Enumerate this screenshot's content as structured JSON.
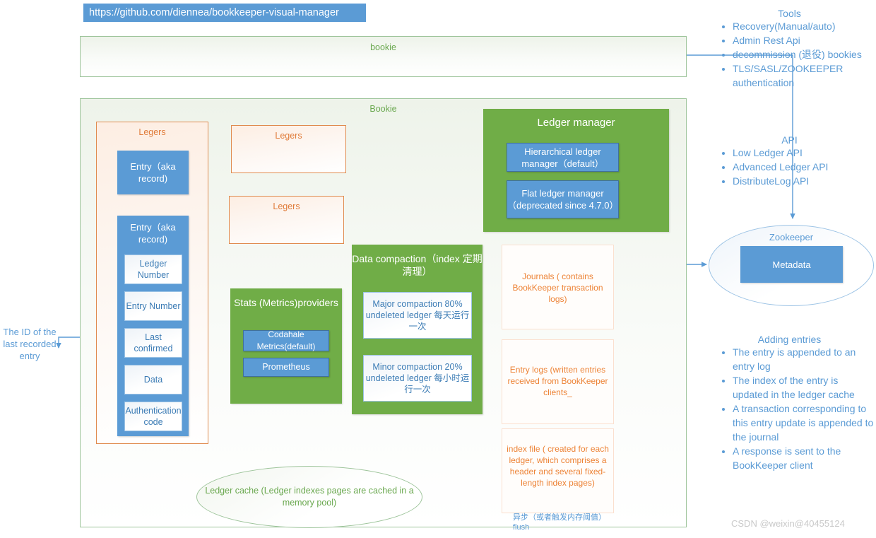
{
  "url_chip": {
    "text": "https://github.com/diennea/bookkeeper-visual-manager"
  },
  "colors": {
    "blue": "#5b9bd5",
    "green": "#70ad47",
    "orange": "#ed8336",
    "green_border": "#9dc49a",
    "orange_border": "#e08b4f"
  },
  "bookie_bar": {
    "title": "bookie"
  },
  "bookie_panel": {
    "title": "Bookie"
  },
  "legers_main": {
    "title": "Legers",
    "entry_simple": "Entry（aka record)",
    "entry_detailed": "Entry（aka record)",
    "fields": [
      "Ledger Number",
      "Entry Number",
      "Last confirmed",
      "Data",
      "Authentication code"
    ]
  },
  "legers_extra": [
    {
      "title": "Legers"
    },
    {
      "title": "Legers"
    }
  ],
  "stats": {
    "title": "Stats (Metrics)providers",
    "items": [
      "Codahale Metrics(default)",
      "Prometheus"
    ]
  },
  "data_compaction": {
    "title": "Data compaction（index 定期清理）",
    "items": [
      "Major compaction 80% undeleted ledger 每天运行一次",
      "Minor compaction 20% undeleted ledger 每小时运行一次"
    ]
  },
  "ledger_manager": {
    "title": "Ledger manager",
    "items": [
      "Hierarchical ledger manager（default）",
      "Flat ledger manager（deprecated since 4.7.0）"
    ]
  },
  "storage": {
    "journals": "Journals ( contains BookKeeper transaction logs)",
    "entry_logs": "Entry logs (written entries received from BookKeeper clients_",
    "index_file": "index file ( created for each ledger, which comprises a header and several fixed-length index pages)"
  },
  "ledger_cache": {
    "text": "Ledger cache (Ledger indexes pages are cached in a memory pool)"
  },
  "annotations": {
    "last_confirmed": "The ID of the last recorded entry",
    "flush_note": "异步（或者触发内存阈值）flush"
  },
  "tools": {
    "title": "Tools",
    "items": [
      "Recovery(Manual/auto)",
      "Admin Rest Api",
      "decommission (退役) bookies",
      "TLS/SASL/ZOOKEEPER authentication"
    ]
  },
  "api": {
    "title": "API",
    "items": [
      "Low Ledger API",
      "Advanced Ledger API",
      "DistributeLog API"
    ]
  },
  "zookeeper": {
    "title": "Zookeeper",
    "metadata": "Metadata"
  },
  "adding_entries": {
    "title": "Adding entries",
    "items": [
      "The entry is appended to an entry log",
      "The index of the entry is updated in the ledger cache",
      "A transaction corresponding to this entry update is appended to the journal",
      "A response is sent to the BookKeeper client"
    ]
  },
  "watermark": {
    "text": "CSDN @weixin@40455124"
  }
}
